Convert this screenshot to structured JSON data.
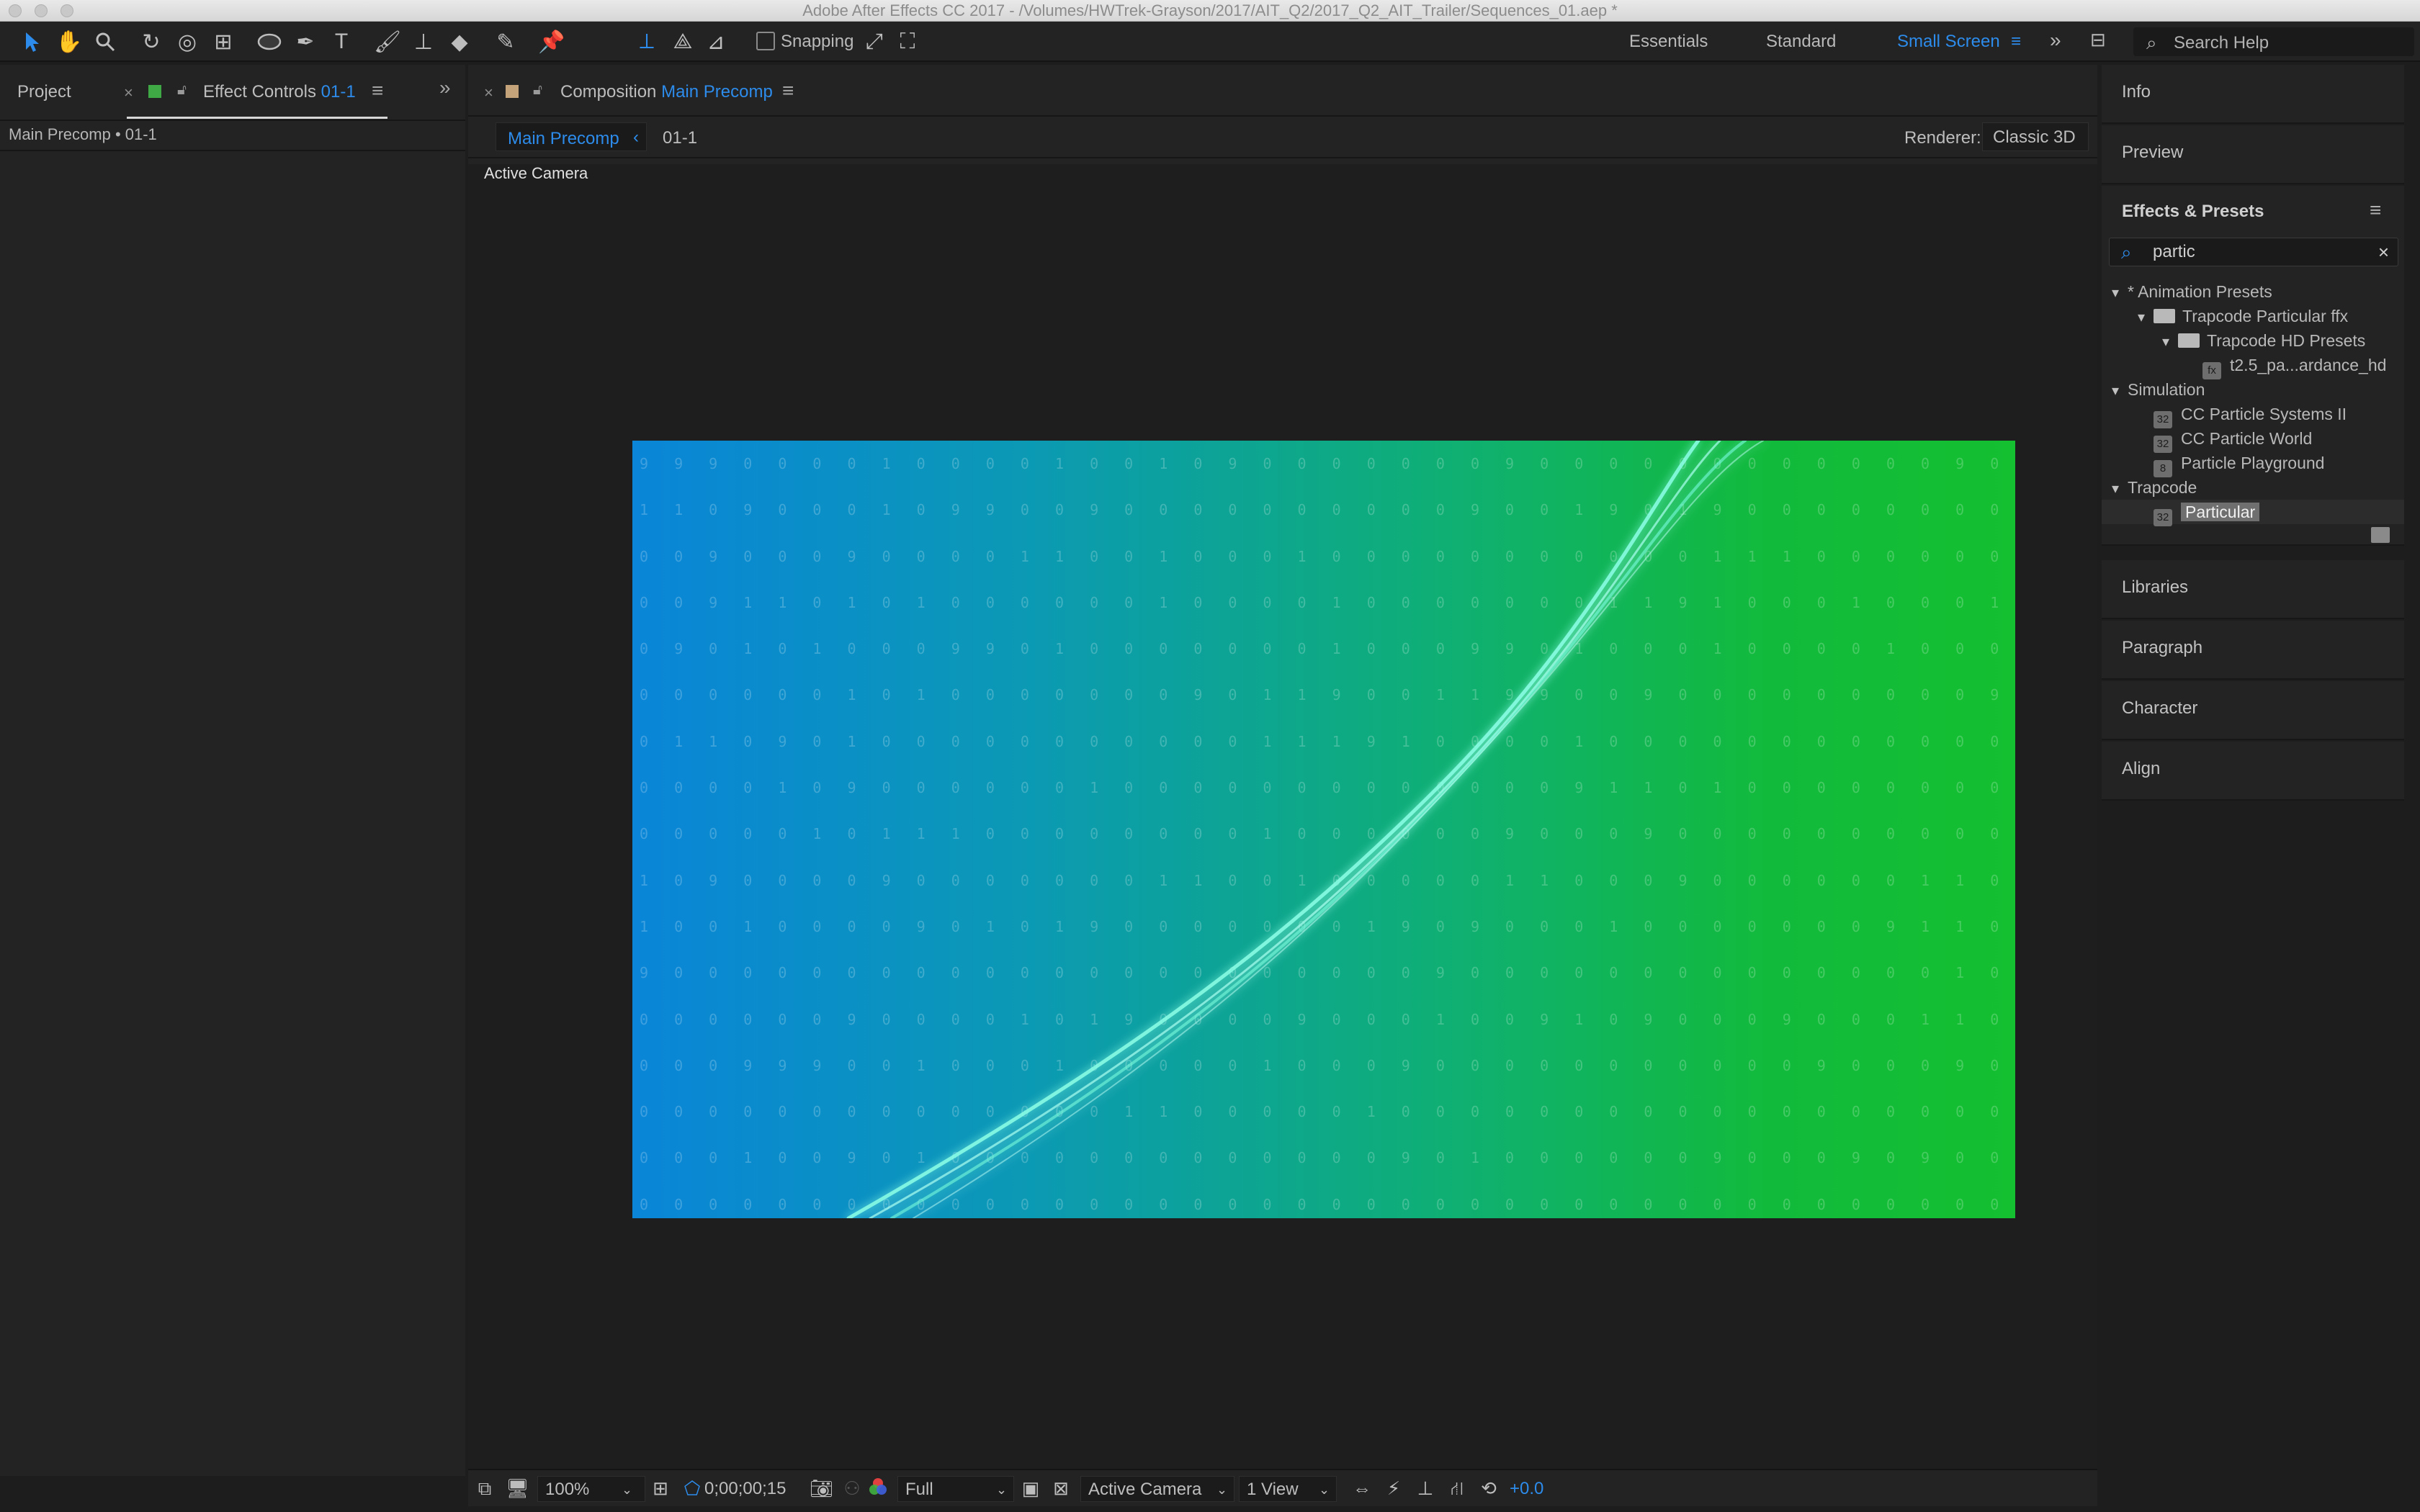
{
  "window": {
    "title": "Adobe After Effects CC 2017 - /Volumes/HWTrek-Grayson/2017/AIT_Q2/2017_Q2_AIT_Trailer/Sequences_01.aep *"
  },
  "toolbar": {
    "snapping_label": "Snapping",
    "workspaces": [
      "Essentials",
      "Standard",
      "Small Screen"
    ],
    "active_workspace": "Small Screen",
    "search_help_placeholder": "Search Help"
  },
  "left_panel": {
    "tabs": {
      "project": "Project",
      "effect_controls": "Effect Controls",
      "effect_controls_layer": "01-1"
    },
    "breadcrumb": "Main Precomp • 01-1"
  },
  "composition_panel": {
    "tab_label": "Composition",
    "tab_comp_name": "Main Precomp",
    "subtabs": [
      "Main Precomp",
      "01-1"
    ],
    "renderer_label": "Renderer:",
    "renderer_value": "Classic 3D",
    "view_label": "Active Camera",
    "comp_bg_colors": [
      "#0a85d8",
      "#14bf30"
    ],
    "binary_rows": [
      "9 9 9 0 0 0 0 1 0 0 0 0 1 0 0 1 0 9 0 0 0 0 0 0 0 9 0 0 0 0 0 0 0 0 0 0 0 0 9 0 0 0 1 9 9 9 9 0 0 0 0 0 0 0 0 0 0 0 0 1",
      "1 1 0 9 0 0 0 1 0 9 9 0 0 9 0 0 0 0 0 0 0 0 0 0 9 0 0 1 9 0 1 9 0 0 0 0 0 0 0 0 0 0 0 9 0 9 0 0 0 0 1 9 9 9 0 0 0 0 1 0 0 9",
      "0 0 9 0 0 0 9 0 0 0 0 1 1 0 0 1 0 0 0 1 0 0 0 0 0 0 0 0 0 0 0 1 1 1 0 0 0 0 0 0 9 0 0 0 9 1 0 9 0 0 1 0 0 0 1 0 0 0 1 0 0 1",
      "0 0 9 1 1 0 1 0 1 0 0 0 0 0 0 1 0 0 0 0 1 0 0 0 0 0 0 0 1 1 9 1 0 0 0 1 0 0 0 1 1 0 1 0 0 1 1 0 0 0 1 0 0 9 1 0 0 1 0",
      "0 9 0 1 0 1 0 0 0 9 9 0 1 0 0 0 0 0 0 0 1 0 0 0 9 9 0 1 0 0 0 1 0 0 0 0 1 0 0 0 0 0 0 1 0 0 9 0 1 0 0 0 0 0 0 9 0 9 0 0 0",
      "0 0 0 0 0 0 1 0 1 0 0 0 0 0 0 0 9 0 1 1 9 0 0 1 1 9 9 0 0 9 0 0 0 0 0 0 0 0 0 9 0 0 0 0 0 0 0 0 9 0 0 0 9 1 0 0 0 0 0 1",
      "0 1 1 0 9 0 1 0 0 0 0 0 0 0 0 0 0 0 1 1 1 9 1 0 0 0 0 1 0 0 0 0 0 0 0 0 0 0 0 0 0 0 1 9 9 0 0 0 0 9 9 0 0 0 0 1 0 0 0",
      "0 0 0 0 1 0 9 0 0 0 0 0 0 1 0 0 0 0 0 0 0 0 0 0 0 0 0 9 1 1 0 1 0 0 0 0 0 0 0 0 0 0 0 0 1 0 1 9 0 1 0 0 0 0 0 1 0 1 0 0",
      "0 0 0 0 0 1 0 1 1 1 0 0 0 0 0 0 0 0 1 0 0 0 0 0 0 9 0 0 0 9 0 0 0 0 0 0 0 0 0 0 0 0 0 0 0 0 0 9 9 9 1 0 0 0 0 0 1 0 1 0 0",
      "1 0 9 0 0 0 0 9 0 0 0 0 0 0 0 1 1 0 0 1 0 0 0 0 0 1 1 0 0 0 9 0 0 0 0 0 0 1 1 0 0 0 0 0 0 0 1 0 0 1 1 0 0 0 1 0 0 0 0",
      "1 0 0 1 0 0 0 0 9 0 1 0 1 9 0 0 0 0 0 0 0 1 9 0 9 0 0 0 1 0 0 0 0 0 0 0 9 1 1 0 0 0 9 0 1 9 0 0 0 0 1 0 0 0 0 1 0 0 9 0",
      "9 0 0 0 0 0 0 0 0 0 0 0 0 0 0 0 0 0 0 0 0 0 0 9 0 0 0 0 0 0 0 0 0 0 0 0 0 0 1 0 0 0 0 0 0 0 0 0 0 0 0 0 0 0 0 0 9 0 0 0",
      "0 0 0 0 0 0 9 0 0 0 0 1 0 1 9 0 0 0 0 9 0 0 0 1 0 0 9 1 0 9 0 0 0 9 0 0 0 1 1 0 0 9 1 9 0 0 0 1 0 0 0 0 9 0 0 9 0 9 0 0",
      "0 0 0 9 9 9 0 0 1 0 0 0 1 0 0 0 0 0 1 0 0 0 9 0 0 0 0 0 0 0 0 0 0 0 9 0 0 0 9 0 0 0 0 0 0 1 0 0 0 0 0 9 0 9 0 0 0 0 0 0",
      "0 0 0 0 0 0 0 0 0 0 0 0 0 0 1 1 0 0 0 0 0 1 0 0 0 0 0 0 0 0 0 0 0 0 0 0 0 0 0 0 0 0 9 0 0 0 0 0 0 0 0 1 0 0 0 1 0 0 0",
      "0 0 0 1 0 0 9 0 1 0 0 0 0 0 0 0 0 0 0 0 0 0 9 0 1 0 0 0 0 0 0 9 0 0 0 9 0 9 0 0 0 0 9 0 0 0 0 9 0 1 1 1 0 0 1 0 0 0 0 0",
      "0 0 0 0 0 0 0 0 0 0 0 0 0 0 0 0 0 0 0 0 0 0 0 0 0 0 0 0 0 0 0 0 0 0 0 0 0 0 0 0 0 0 0 0 0 0 0 9 0 0 0 0 0 0 0 0 0 0 0 0"
    ]
  },
  "viewer_bar": {
    "zoom": "100%",
    "timecode": "0;00;00;15",
    "resolution": "Full",
    "camera": "Active Camera",
    "views": "1 View",
    "exposure": "+0.0"
  },
  "right_panel": {
    "headers_top": [
      "Info",
      "Preview"
    ],
    "effects_presets_title": "Effects & Presets",
    "search_value": "partic",
    "tree": [
      {
        "label": "* Animation Presets",
        "type": "group",
        "depth": 0
      },
      {
        "label": "Trapcode Particular ffx",
        "type": "folder",
        "depth": 1
      },
      {
        "label": "Trapcode HD Presets",
        "type": "folder",
        "depth": 2
      },
      {
        "label": "t2.5_pa...ardance_hd",
        "type": "preset",
        "depth": 3
      },
      {
        "label": "Simulation",
        "type": "group",
        "depth": 0
      },
      {
        "label": "CC Particle Systems II",
        "type": "effect",
        "depth": 1
      },
      {
        "label": "CC Particle World",
        "type": "effect",
        "depth": 1
      },
      {
        "label": "Particle Playground",
        "type": "effect",
        "depth": 1
      },
      {
        "label": "Trapcode",
        "type": "group",
        "depth": 0
      },
      {
        "label": "Particular",
        "type": "effect",
        "depth": 1,
        "selected": true
      }
    ],
    "headers_bottom": [
      "Libraries",
      "Paragraph",
      "Character",
      "Align"
    ]
  },
  "colors": {
    "accent": "#2d8ceb",
    "panel_bg": "#232323",
    "app_bg": "#1d1d1d",
    "label_green": "#3faa45",
    "label_tan": "#c4a27a"
  }
}
